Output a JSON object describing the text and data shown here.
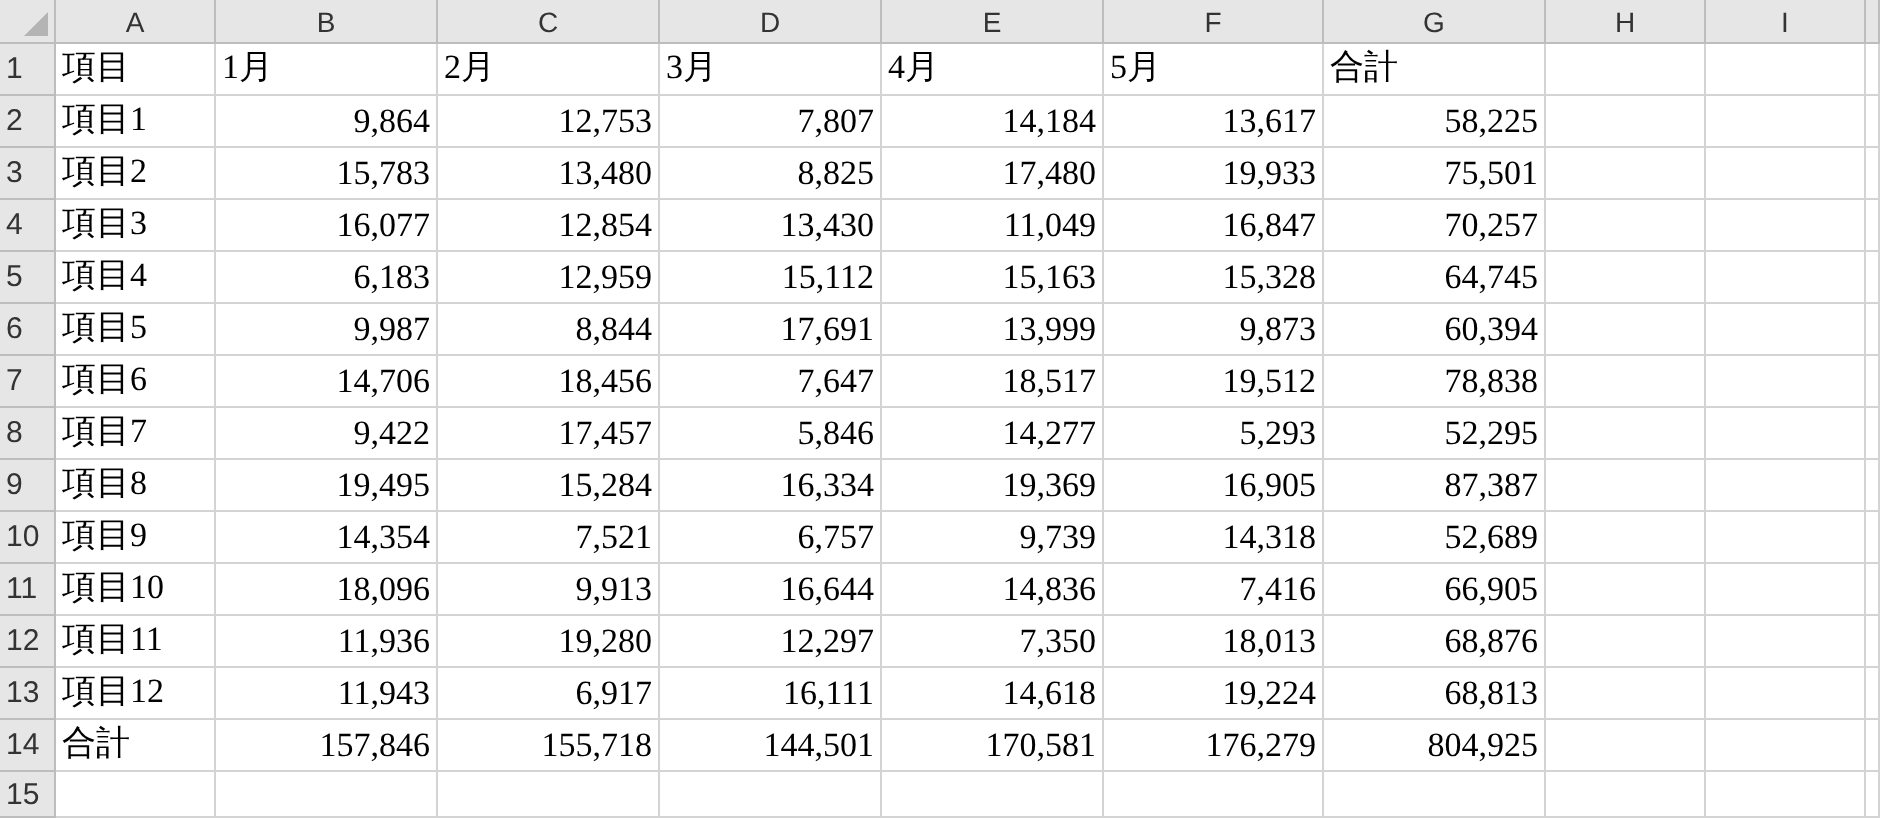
{
  "columns": [
    "A",
    "B",
    "C",
    "D",
    "E",
    "F",
    "G",
    "H",
    "I"
  ],
  "rows": [
    {
      "number": "1",
      "cells": [
        "項目",
        "1月",
        "2月",
        "3月",
        "4月",
        "5月",
        "合計"
      ]
    },
    {
      "number": "2",
      "cells": [
        "項目1",
        "9,864",
        "12,753",
        "7,807",
        "14,184",
        "13,617",
        "58,225"
      ]
    },
    {
      "number": "3",
      "cells": [
        "項目2",
        "15,783",
        "13,480",
        "8,825",
        "17,480",
        "19,933",
        "75,501"
      ]
    },
    {
      "number": "4",
      "cells": [
        "項目3",
        "16,077",
        "12,854",
        "13,430",
        "11,049",
        "16,847",
        "70,257"
      ]
    },
    {
      "number": "5",
      "cells": [
        "項目4",
        "6,183",
        "12,959",
        "15,112",
        "15,163",
        "15,328",
        "64,745"
      ]
    },
    {
      "number": "6",
      "cells": [
        "項目5",
        "9,987",
        "8,844",
        "17,691",
        "13,999",
        "9,873",
        "60,394"
      ]
    },
    {
      "number": "7",
      "cells": [
        "項目6",
        "14,706",
        "18,456",
        "7,647",
        "18,517",
        "19,512",
        "78,838"
      ]
    },
    {
      "number": "8",
      "cells": [
        "項目7",
        "9,422",
        "17,457",
        "5,846",
        "14,277",
        "5,293",
        "52,295"
      ]
    },
    {
      "number": "9",
      "cells": [
        "項目8",
        "19,495",
        "15,284",
        "16,334",
        "19,369",
        "16,905",
        "87,387"
      ]
    },
    {
      "number": "10",
      "cells": [
        "項目9",
        "14,354",
        "7,521",
        "6,757",
        "9,739",
        "14,318",
        "52,689"
      ]
    },
    {
      "number": "11",
      "cells": [
        "項目10",
        "18,096",
        "9,913",
        "16,644",
        "14,836",
        "7,416",
        "66,905"
      ]
    },
    {
      "number": "12",
      "cells": [
        "項目11",
        "11,936",
        "19,280",
        "12,297",
        "7,350",
        "18,013",
        "68,876"
      ]
    },
    {
      "number": "13",
      "cells": [
        "項目12",
        "11,943",
        "6,917",
        "16,111",
        "14,618",
        "19,224",
        "68,813"
      ]
    },
    {
      "number": "14",
      "cells": [
        "合計",
        "157,846",
        "155,718",
        "144,501",
        "170,581",
        "176,279",
        "804,925"
      ]
    },
    {
      "number": "15",
      "cells": []
    }
  ]
}
